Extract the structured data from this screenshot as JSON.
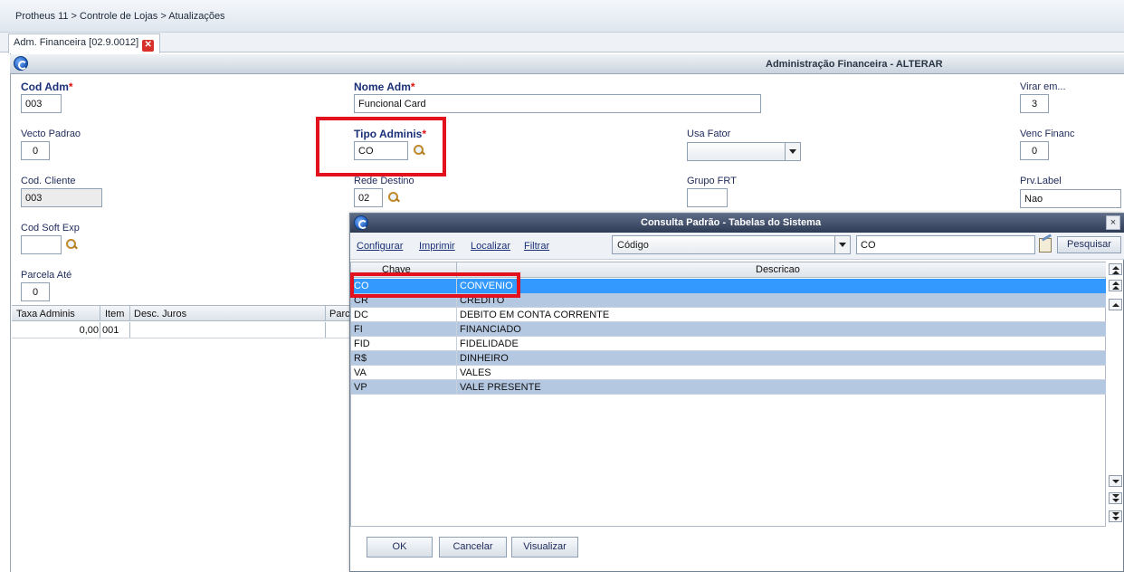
{
  "breadcrumb": "Protheus 11 > Controle de Lojas > Atualizações",
  "tab": {
    "label": "Adm. Financeira [02.9.0012]"
  },
  "form": {
    "title": "Administração Financeira - ALTERAR",
    "fields": {
      "cod_adm": {
        "label": "Cod Adm",
        "value": "003",
        "required": "*"
      },
      "nome_adm": {
        "label": "Nome Adm",
        "value": "Funcional Card",
        "required": "*"
      },
      "virar_em": {
        "label": "Virar em...",
        "value": "3"
      },
      "vecto_padrao": {
        "label": "Vecto Padrao",
        "value": "0"
      },
      "tipo_adminis": {
        "label": "Tipo Adminis",
        "value": "CO",
        "required": "*"
      },
      "usa_fator": {
        "label": "Usa Fator",
        "value": ""
      },
      "venc_financ": {
        "label": "Venc Financ",
        "value": "0"
      },
      "cod_cliente": {
        "label": "Cod. Cliente",
        "value": "003"
      },
      "rede_destino": {
        "label": "Rede Destino",
        "value": "02"
      },
      "grupo_frt": {
        "label": "Grupo FRT",
        "value": ""
      },
      "prv_label": {
        "label": "Prv.Label",
        "value": "Nao"
      },
      "cod_soft_exp": {
        "label": "Cod Soft Exp",
        "value": ""
      },
      "parcela_ate": {
        "label": "Parcela Até",
        "value": "0"
      }
    },
    "grid": {
      "headers": [
        "Taxa Adminis",
        "Item",
        "Desc. Juros",
        "Parc"
      ],
      "row": [
        "0,00",
        "001",
        "",
        ""
      ]
    }
  },
  "dialog": {
    "title": "Consulta Padrão - Tabelas do Sistema",
    "close": "×",
    "links": [
      "Configurar",
      "Imprimir",
      "Localizar",
      "Filtrar"
    ],
    "order_select": "Código",
    "search_value": "CO",
    "search_button": "Pesquisar",
    "columns": [
      "Chave",
      "Descricao"
    ],
    "rows": [
      {
        "key": "CO",
        "desc": "CONVENIO"
      },
      {
        "key": "CR",
        "desc": "CREDITO"
      },
      {
        "key": "DC",
        "desc": "DEBITO EM CONTA CORRENTE"
      },
      {
        "key": "FI",
        "desc": "FINANCIADO"
      },
      {
        "key": "FID",
        "desc": "FIDELIDADE"
      },
      {
        "key": "R$",
        "desc": "DINHEIRO"
      },
      {
        "key": "VA",
        "desc": "VALES"
      },
      {
        "key": "VP",
        "desc": "VALE PRESENTE"
      }
    ],
    "buttons": {
      "ok": "OK",
      "cancel": "Cancelar",
      "view": "Visualizar"
    }
  },
  "colors": {
    "selected_row": "#3399ff",
    "alt_row": "#b5c8e2",
    "highlight_border": "#e3101e",
    "label_blue": "#1a2f78"
  }
}
